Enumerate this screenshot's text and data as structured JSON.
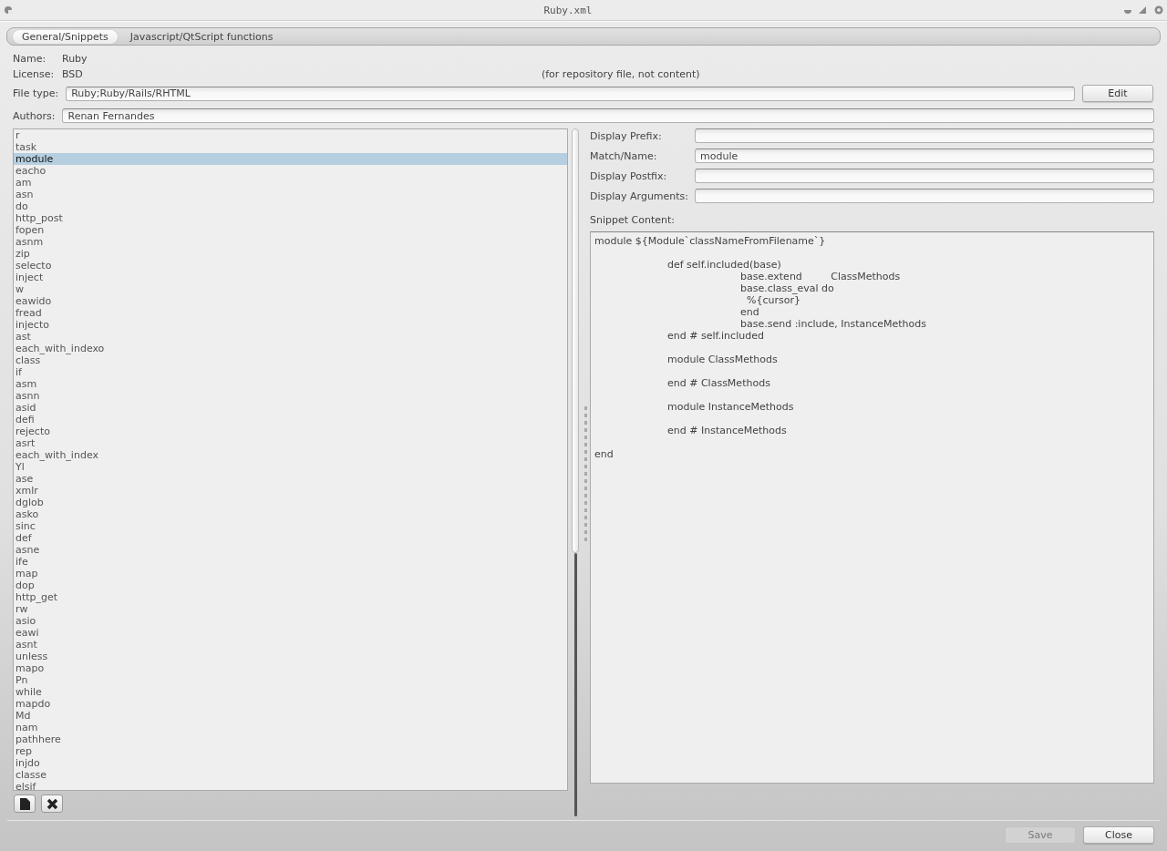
{
  "window": {
    "title": "Ruby.xml"
  },
  "tabs": [
    {
      "label": "General/Snippets",
      "selected": true
    },
    {
      "label": "Javascript/QtScript functions",
      "selected": false
    }
  ],
  "info": {
    "name_label": "Name:",
    "name_value": "Ruby",
    "license_label": "License:",
    "license_value": "BSD",
    "license_note": "(for repository file, not content)"
  },
  "file_type": {
    "label": "File type:",
    "value": "Ruby;Ruby/Rails/RHTML",
    "button": "Edit"
  },
  "authors": {
    "label": "Authors:",
    "value": "Renan Fernandes"
  },
  "snippets": [
    {
      "label": "r",
      "selected": false
    },
    {
      "label": "task",
      "selected": false
    },
    {
      "label": "module",
      "selected": true
    },
    {
      "label": "eacho",
      "selected": false
    },
    {
      "label": "am",
      "selected": false
    },
    {
      "label": "asn",
      "selected": false
    },
    {
      "label": "do",
      "selected": false
    },
    {
      "label": "http_post",
      "selected": false
    },
    {
      "label": "fopen",
      "selected": false
    },
    {
      "label": "asnm",
      "selected": false
    },
    {
      "label": "zip",
      "selected": false
    },
    {
      "label": "selecto",
      "selected": false
    },
    {
      "label": "inject",
      "selected": false
    },
    {
      "label": "w",
      "selected": false
    },
    {
      "label": "eawido",
      "selected": false
    },
    {
      "label": "fread",
      "selected": false
    },
    {
      "label": "injecto",
      "selected": false
    },
    {
      "label": "ast",
      "selected": false
    },
    {
      "label": "each_with_indexo",
      "selected": false
    },
    {
      "label": "class",
      "selected": false
    },
    {
      "label": "if",
      "selected": false
    },
    {
      "label": "asm",
      "selected": false
    },
    {
      "label": "asnn",
      "selected": false
    },
    {
      "label": "asid",
      "selected": false
    },
    {
      "label": "defi",
      "selected": false
    },
    {
      "label": "rejecto",
      "selected": false
    },
    {
      "label": "asrt",
      "selected": false
    },
    {
      "label": "each_with_index",
      "selected": false
    },
    {
      "label": "Yl",
      "selected": false
    },
    {
      "label": "ase",
      "selected": false
    },
    {
      "label": "xmlr",
      "selected": false
    },
    {
      "label": "dglob",
      "selected": false
    },
    {
      "label": "asko",
      "selected": false
    },
    {
      "label": "sinc",
      "selected": false
    },
    {
      "label": "def",
      "selected": false
    },
    {
      "label": "asne",
      "selected": false
    },
    {
      "label": "ife",
      "selected": false
    },
    {
      "label": "map",
      "selected": false
    },
    {
      "label": "dop",
      "selected": false
    },
    {
      "label": "http_get",
      "selected": false
    },
    {
      "label": "rw",
      "selected": false
    },
    {
      "label": "asio",
      "selected": false
    },
    {
      "label": "eawi",
      "selected": false
    },
    {
      "label": "asnt",
      "selected": false
    },
    {
      "label": "unless",
      "selected": false
    },
    {
      "label": "mapo",
      "selected": false
    },
    {
      "label": "Pn",
      "selected": false
    },
    {
      "label": "while",
      "selected": false
    },
    {
      "label": "mapdo",
      "selected": false
    },
    {
      "label": "Md",
      "selected": false
    },
    {
      "label": "nam",
      "selected": false
    },
    {
      "label": "pathhere",
      "selected": false
    },
    {
      "label": "rep",
      "selected": false
    },
    {
      "label": "injdo",
      "selected": false
    },
    {
      "label": "classe",
      "selected": false
    },
    {
      "label": "elsif",
      "selected": false
    }
  ],
  "snippet_form": {
    "fields": [
      {
        "label": "Display Prefix:"
      },
      {
        "label": "Match/Name:",
        "value": "module"
      },
      {
        "label": "Display Postfix:"
      },
      {
        "label": "Display Arguments:"
      }
    ],
    "content_label": "Snippet Content:",
    "content": "module ${Module`classNameFromFilename`}\n\n\tdef self.included(base)\n\t\tbase.extend         ClassMethods\n\t\tbase.class_eval do\n\t\t  %{cursor}\n\t\tend\n\t\tbase.send :include, InstanceMethods\n\tend # self.included\n\n\tmodule ClassMethods\n\n\tend # ClassMethods\n\n\tmodule InstanceMethods\n\n\tend # InstanceMethods\n\nend"
  },
  "buttons": [
    {
      "label": "Save",
      "disabled": true
    },
    {
      "label": "Close",
      "disabled": false
    }
  ]
}
